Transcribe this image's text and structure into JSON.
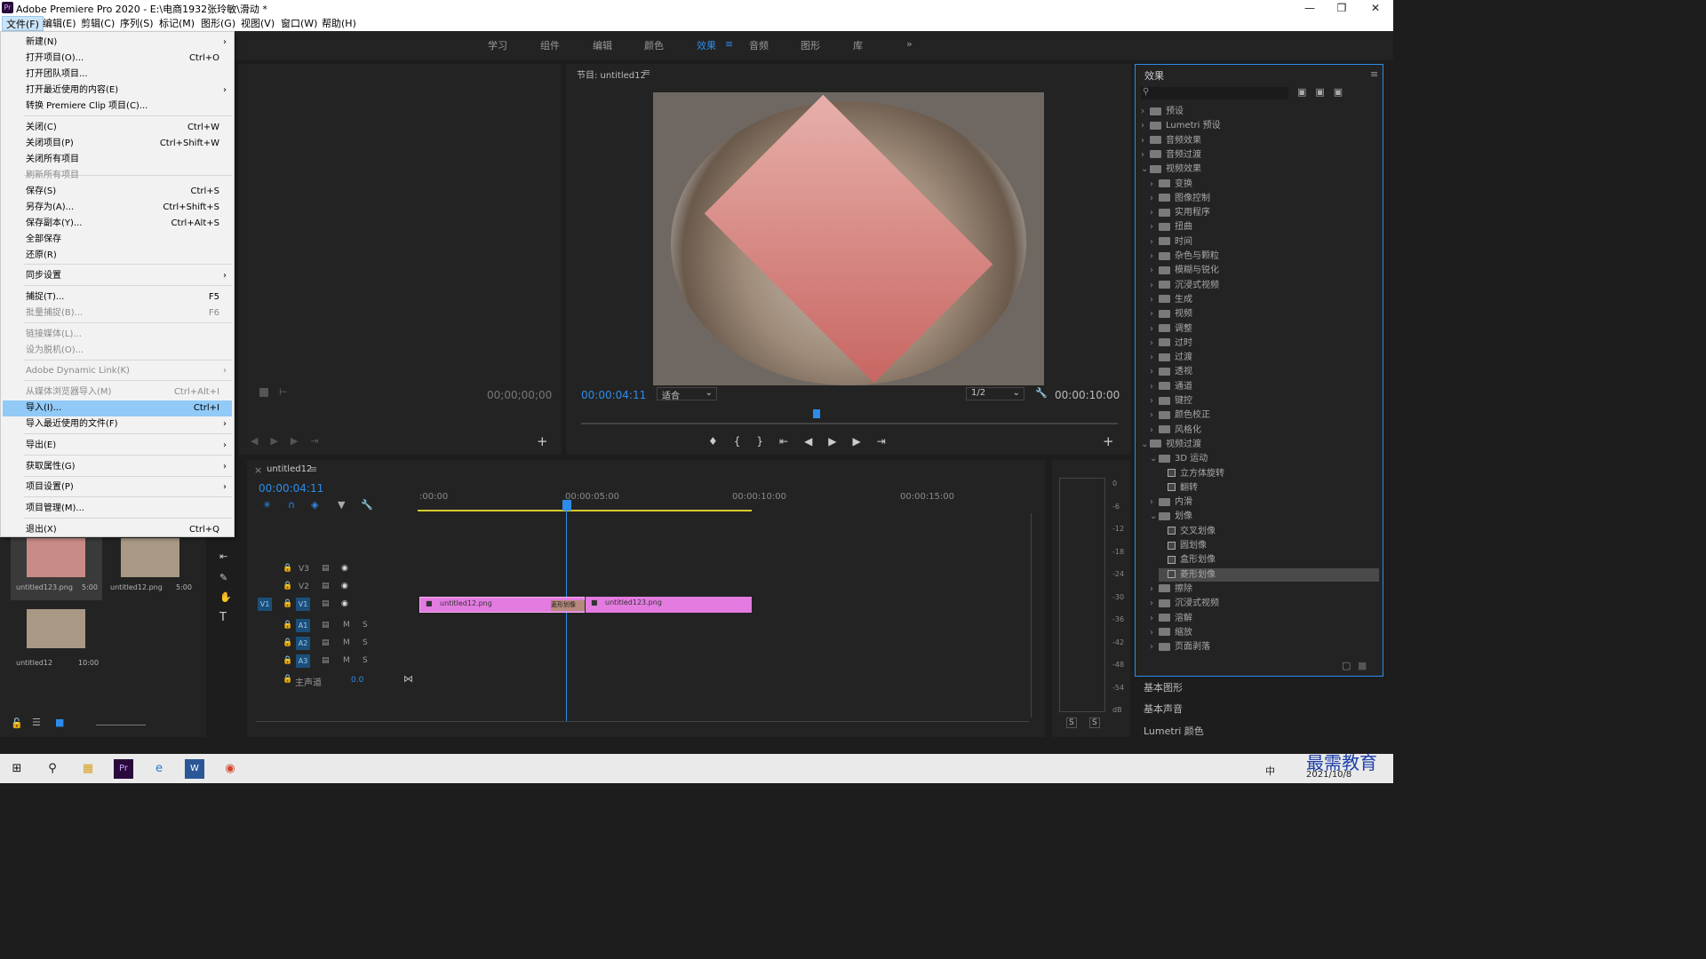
{
  "window": {
    "title": "Adobe Premiere Pro 2020 - E:\\电商1932张玲敏\\滑动 *",
    "app_icon": "Pr"
  },
  "menubar": [
    "文件(F)",
    "编辑(E)",
    "剪辑(C)",
    "序列(S)",
    "标记(M)",
    "图形(G)",
    "视图(V)",
    "窗口(W)",
    "帮助(H)"
  ],
  "workspaces": [
    "学习",
    "组件",
    "编辑",
    "颜色",
    "效果",
    "音频",
    "图形",
    "库"
  ],
  "file_menu": [
    {
      "label": "新建(N)",
      "shortcut": "",
      "arrow": true,
      "disabled": false
    },
    {
      "label": "打开项目(O)...",
      "shortcut": "Ctrl+O",
      "arrow": false,
      "disabled": false
    },
    {
      "label": "打开团队项目...",
      "shortcut": "",
      "arrow": false,
      "disabled": false
    },
    {
      "label": "打开最近使用的内容(E)",
      "shortcut": "",
      "arrow": true,
      "disabled": false
    },
    {
      "label": "转换 Premiere Clip 项目(C)...",
      "shortcut": "",
      "arrow": false,
      "disabled": false
    },
    {
      "label": "关闭(C)",
      "shortcut": "Ctrl+W",
      "arrow": false,
      "disabled": false
    },
    {
      "label": "关闭项目(P)",
      "shortcut": "Ctrl+Shift+W",
      "arrow": false,
      "disabled": false
    },
    {
      "label": "关闭所有项目",
      "shortcut": "",
      "arrow": false,
      "disabled": false
    },
    {
      "label": "刷新所有项目",
      "shortcut": "",
      "arrow": false,
      "disabled": true
    },
    {
      "label": "保存(S)",
      "shortcut": "Ctrl+S",
      "arrow": false,
      "disabled": false
    },
    {
      "label": "另存为(A)...",
      "shortcut": "Ctrl+Shift+S",
      "arrow": false,
      "disabled": false
    },
    {
      "label": "保存副本(Y)...",
      "shortcut": "Ctrl+Alt+S",
      "arrow": false,
      "disabled": false
    },
    {
      "label": "全部保存",
      "shortcut": "",
      "arrow": false,
      "disabled": false
    },
    {
      "label": "还原(R)",
      "shortcut": "",
      "arrow": false,
      "disabled": false
    },
    {
      "label": "同步设置",
      "shortcut": "",
      "arrow": true,
      "disabled": false
    },
    {
      "label": "捕捉(T)...",
      "shortcut": "F5",
      "arrow": false,
      "disabled": false
    },
    {
      "label": "批量捕捉(B)...",
      "shortcut": "F6",
      "arrow": false,
      "disabled": true
    },
    {
      "label": "链接媒体(L)...",
      "shortcut": "",
      "arrow": false,
      "disabled": true
    },
    {
      "label": "设为脱机(O)...",
      "shortcut": "",
      "arrow": false,
      "disabled": true
    },
    {
      "label": "Adobe Dynamic Link(K)",
      "shortcut": "",
      "arrow": true,
      "disabled": true
    },
    {
      "label": "从媒体浏览器导入(M)",
      "shortcut": "Ctrl+Alt+I",
      "arrow": false,
      "disabled": true
    },
    {
      "label": "导入(I)...",
      "shortcut": "Ctrl+I",
      "arrow": false,
      "disabled": false,
      "highlight": true
    },
    {
      "label": "导入最近使用的文件(F)",
      "shortcut": "",
      "arrow": true,
      "disabled": false
    },
    {
      "label": "导出(E)",
      "shortcut": "",
      "arrow": true,
      "disabled": false
    },
    {
      "label": "获取属性(G)",
      "shortcut": "",
      "arrow": true,
      "disabled": false
    },
    {
      "label": "项目设置(P)",
      "shortcut": "",
      "arrow": true,
      "disabled": false
    },
    {
      "label": "项目管理(M)...",
      "shortcut": "",
      "arrow": false,
      "disabled": false
    },
    {
      "label": "退出(X)",
      "shortcut": "Ctrl+Q",
      "arrow": false,
      "disabled": false
    }
  ],
  "source_monitor": {
    "timecode": "00;00;00;00"
  },
  "program_monitor": {
    "title": "节目: untitled12",
    "timecode": "00:00:04:11",
    "fit": "适合",
    "resolution": "1/2",
    "duration": "00:00:10:00"
  },
  "project_items": [
    {
      "name": "untitled123.png",
      "dur": "5:00"
    },
    {
      "name": "untitled12.png",
      "dur": "5:00"
    },
    {
      "name": "untitled12",
      "dur": "10:00"
    }
  ],
  "timeline": {
    "tab": "untitled12",
    "timecode": "00:00:04:11",
    "ruler": [
      ":00:00",
      "00:00:05:00",
      "00:00:10:00",
      "00:00:15:00"
    ],
    "video_tracks": [
      "V3",
      "V2",
      "V1"
    ],
    "audio_tracks": [
      "A1",
      "A2",
      "A3"
    ],
    "master_label": "主声道",
    "master_value": "0.0",
    "source_patch": "V1",
    "clips": [
      {
        "name": "untitled12.png"
      },
      {
        "name": "untitled123.png"
      }
    ],
    "transition_label": "菱形划像"
  },
  "meter_labels": [
    "0",
    "-6",
    "-12",
    "-18",
    "-24",
    "-30",
    "-36",
    "-42",
    "-48",
    "-54",
    "dB"
  ],
  "meter_solo": [
    "S",
    "S"
  ],
  "effects_panel": {
    "title": "效果",
    "tree": [
      {
        "label": "预设",
        "level": 0,
        "type": "folder",
        "open": false
      },
      {
        "label": "Lumetri 预设",
        "level": 0,
        "type": "folder",
        "open": false
      },
      {
        "label": "音频效果",
        "level": 0,
        "type": "folder",
        "open": false
      },
      {
        "label": "音频过渡",
        "level": 0,
        "type": "folder",
        "open": false
      },
      {
        "label": "视频效果",
        "level": 0,
        "type": "folder",
        "open": true
      },
      {
        "label": "变换",
        "level": 1,
        "type": "folder",
        "open": false
      },
      {
        "label": "图像控制",
        "level": 1,
        "type": "folder",
        "open": false
      },
      {
        "label": "实用程序",
        "level": 1,
        "type": "folder",
        "open": false
      },
      {
        "label": "扭曲",
        "level": 1,
        "type": "folder",
        "open": false
      },
      {
        "label": "时间",
        "level": 1,
        "type": "folder",
        "open": false
      },
      {
        "label": "杂色与颗粒",
        "level": 1,
        "type": "folder",
        "open": false
      },
      {
        "label": "模糊与锐化",
        "level": 1,
        "type": "folder",
        "open": false
      },
      {
        "label": "沉浸式视频",
        "level": 1,
        "type": "folder",
        "open": false
      },
      {
        "label": "生成",
        "level": 1,
        "type": "folder",
        "open": false
      },
      {
        "label": "视频",
        "level": 1,
        "type": "folder",
        "open": false
      },
      {
        "label": "调整",
        "level": 1,
        "type": "folder",
        "open": false
      },
      {
        "label": "过时",
        "level": 1,
        "type": "folder",
        "open": false
      },
      {
        "label": "过渡",
        "level": 1,
        "type": "folder",
        "open": false
      },
      {
        "label": "透视",
        "level": 1,
        "type": "folder",
        "open": false
      },
      {
        "label": "通道",
        "level": 1,
        "type": "folder",
        "open": false
      },
      {
        "label": "键控",
        "level": 1,
        "type": "folder",
        "open": false
      },
      {
        "label": "颜色校正",
        "level": 1,
        "type": "folder",
        "open": false
      },
      {
        "label": "风格化",
        "level": 1,
        "type": "folder",
        "open": false
      },
      {
        "label": "视频过渡",
        "level": 0,
        "type": "folder",
        "open": true
      },
      {
        "label": "3D 运动",
        "level": 1,
        "type": "folder",
        "open": true
      },
      {
        "label": "立方体旋转",
        "level": 2,
        "type": "effect"
      },
      {
        "label": "翻转",
        "level": 2,
        "type": "effect"
      },
      {
        "label": "内滑",
        "level": 1,
        "type": "folder",
        "open": false
      },
      {
        "label": "划像",
        "level": 1,
        "type": "folder",
        "open": true
      },
      {
        "label": "交叉划像",
        "level": 2,
        "type": "effect"
      },
      {
        "label": "圆划像",
        "level": 2,
        "type": "effect"
      },
      {
        "label": "盒形划像",
        "level": 2,
        "type": "effect"
      },
      {
        "label": "菱形划像",
        "level": 2,
        "type": "effect",
        "selected": true
      },
      {
        "label": "擦除",
        "level": 1,
        "type": "folder",
        "open": false
      },
      {
        "label": "沉浸式视频",
        "level": 1,
        "type": "folder",
        "open": false
      },
      {
        "label": "溶解",
        "level": 1,
        "type": "folder",
        "open": false
      },
      {
        "label": "缩放",
        "level": 1,
        "type": "folder",
        "open": false
      },
      {
        "label": "页面剥落",
        "level": 1,
        "type": "folder",
        "open": false
      }
    ],
    "bottom": [
      "基本图形",
      "基本声音",
      "Lumetri 颜色"
    ]
  },
  "taskbar": {
    "clock_date": "2021/10/8",
    "clock_time": "",
    "ime": "中",
    "watermark": "最需教育"
  },
  "colors": {
    "accent": "#2d8ceb",
    "clip": "#e47be0",
    "playhead": "#2d8ceb",
    "highlight": "#91c9f7"
  }
}
